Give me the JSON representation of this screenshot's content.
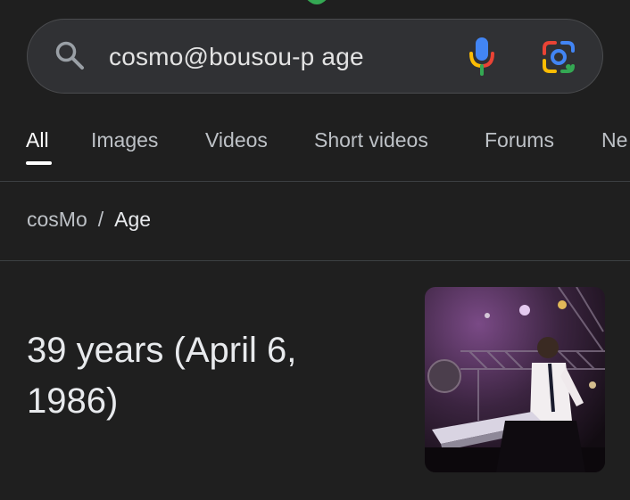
{
  "search": {
    "query": "cosmo@bousou-p age"
  },
  "tabs": [
    {
      "label": "All",
      "active": true
    },
    {
      "label": "Images",
      "active": false
    },
    {
      "label": "Videos",
      "active": false
    },
    {
      "label": "Short videos",
      "active": false
    },
    {
      "label": "Forums",
      "active": false
    },
    {
      "label": "Ne",
      "active": false
    }
  ],
  "breadcrumb": {
    "entity": "cosMo",
    "separator": "/",
    "attribute": "Age"
  },
  "answer": {
    "text": "39 years (April 6, 1986)"
  },
  "thumbnail": {
    "icon": "concert-photo"
  },
  "colors": {
    "background": "#1f1f1f",
    "search_bar": "#303134",
    "text_primary": "#e8eaed",
    "text_secondary": "#bdc1c6"
  }
}
